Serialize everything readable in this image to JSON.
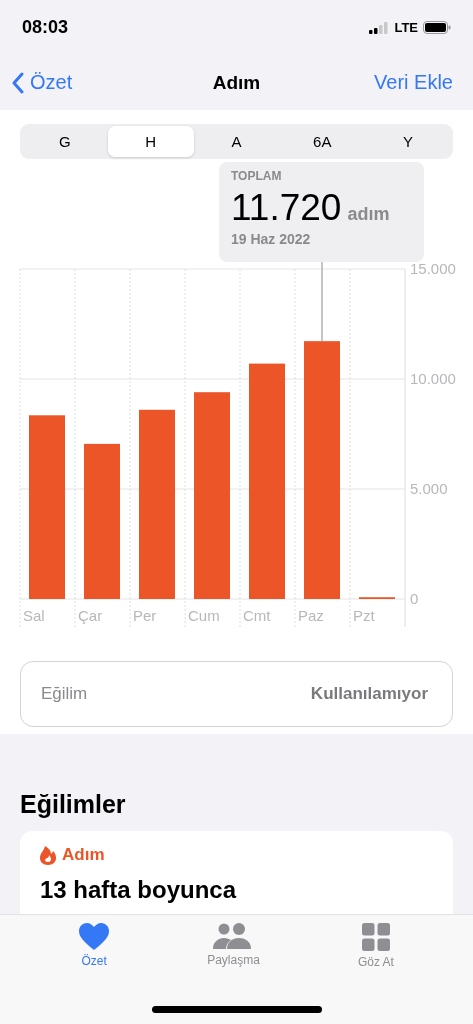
{
  "status_bar": {
    "time": "08:03",
    "network": "LTE"
  },
  "nav": {
    "back": "Özet",
    "title": "Adım",
    "action": "Veri Ekle"
  },
  "segments": [
    {
      "label": "G",
      "selected": false
    },
    {
      "label": "H",
      "selected": true
    },
    {
      "label": "A",
      "selected": false
    },
    {
      "label": "6A",
      "selected": false
    },
    {
      "label": "Y",
      "selected": false
    }
  ],
  "tooltip": {
    "label": "TOPLAM",
    "value": "11.720",
    "unit": "adım",
    "date": "19 Haz 2022"
  },
  "chart_data": {
    "type": "bar",
    "categories": [
      "Sal",
      "Çar",
      "Per",
      "Cum",
      "Cmt",
      "Paz",
      "Pzt"
    ],
    "series": [
      {
        "color": "#eb5528",
        "values": [
          8350,
          7050,
          8600,
          9400,
          10700,
          11720,
          80
        ]
      }
    ],
    "ylim": [
      0,
      15000
    ],
    "yticks": [
      {
        "value": 0,
        "label": "0"
      },
      {
        "value": 5000,
        "label": "5.000"
      },
      {
        "value": 10000,
        "label": "10.000"
      },
      {
        "value": 15000,
        "label": "15.000"
      }
    ]
  },
  "trend_row": {
    "label": "Eğilim",
    "value": "Kullanılamıyor"
  },
  "trends": {
    "title": "Eğilimler",
    "card": {
      "category": "Adım",
      "headline": "13 hafta boyunca"
    }
  },
  "tab_bar": [
    {
      "label": "Özet",
      "kind": "heart",
      "selected": true
    },
    {
      "label": "Paylaşma",
      "kind": "people",
      "selected": false
    },
    {
      "label": "Göz At",
      "kind": "grid",
      "selected": false
    }
  ]
}
